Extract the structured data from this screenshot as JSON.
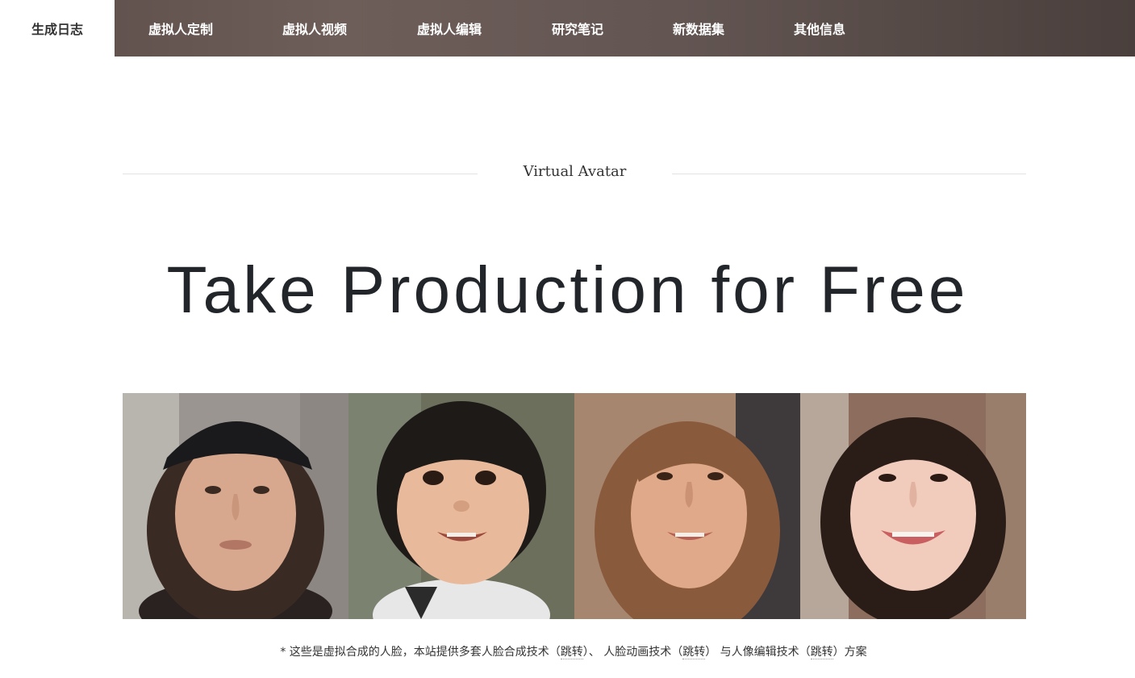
{
  "nav": {
    "items": [
      {
        "label": "生成日志",
        "active": true
      },
      {
        "label": "虚拟人定制"
      },
      {
        "label": "虚拟人视频"
      },
      {
        "label": "虚拟人编辑"
      },
      {
        "label": "研究笔记"
      },
      {
        "label": "新数据集"
      },
      {
        "label": "其他信息"
      }
    ]
  },
  "section": {
    "title": "Virtual Avatar"
  },
  "hero": {
    "title": "Take Production for Free"
  },
  "caption": {
    "prefix": "* 这些是虚拟合成的人脸，本站提供多套人脸合成技术（",
    "link1": "跳转",
    "mid1": "）、 人脸动画技术（",
    "link2": "跳转",
    "mid2": "） 与人像编辑技术（",
    "link3": "跳转",
    "suffix": "）方案"
  },
  "colors": {
    "nav_bg": "#5d4d4a",
    "text_dark": "#222529"
  }
}
